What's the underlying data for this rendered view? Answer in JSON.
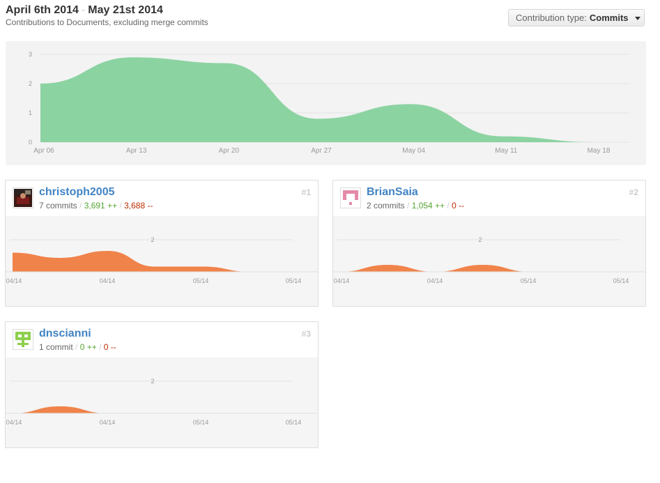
{
  "header": {
    "start_date": "April 6th 2014",
    "separator": "-",
    "end_date": "May 21st 2014",
    "subtitle": "Contributions to Documents, excluding merge commits"
  },
  "contribution_type": {
    "label": "Contribution type:",
    "value": "Commits"
  },
  "colors": {
    "main_area": "#8cd3a2",
    "contributor_area": "#f0834a",
    "link": "#4183c4",
    "additions": "#55a532",
    "deletions": "#bd2c00"
  },
  "chart_data": [
    {
      "type": "area",
      "x": [
        "Apr 06",
        "Apr 13",
        "Apr 20",
        "Apr 27",
        "May 04",
        "May 11",
        "May 18"
      ],
      "values": [
        2,
        2.9,
        2.7,
        0.8,
        1.3,
        0.2,
        0
      ],
      "tick_labels": [
        "Apr 06",
        "Apr 13",
        "Apr 20",
        "Apr 27",
        "May 04",
        "May 11",
        "May 18"
      ],
      "yticks": [
        "0",
        "1",
        "2",
        "3"
      ],
      "ylim": [
        0,
        3
      ],
      "grid": true
    },
    {
      "type": "area",
      "series_owner": "christoph2005",
      "values": [
        1.1,
        0.8,
        1.2,
        0.3,
        0.3,
        0,
        0
      ],
      "tick_labels": [
        "04/14",
        "04/14",
        "05/14",
        "05/14"
      ],
      "ytick": "2",
      "ylim": [
        0,
        2
      ]
    },
    {
      "type": "area",
      "series_owner": "BrianSaia",
      "values": [
        0,
        0.4,
        0,
        0.4,
        0,
        0,
        0
      ],
      "tick_labels": [
        "04/14",
        "04/14",
        "05/14",
        "05/14"
      ],
      "ytick": "2",
      "ylim": [
        0,
        2
      ]
    },
    {
      "type": "area",
      "series_owner": "dnscianni",
      "values": [
        0,
        0.4,
        0,
        0,
        0,
        0,
        0
      ],
      "tick_labels": [
        "04/14",
        "04/14",
        "05/14",
        "05/14"
      ],
      "ytick": "2",
      "ylim": [
        0,
        2
      ]
    }
  ],
  "contributors": [
    {
      "name": "christoph2005",
      "commits": "7 commits",
      "additions": "3,691 ++",
      "deletions": "3,688 --",
      "rank": "#1",
      "avatar": "photo-avatar"
    },
    {
      "name": "BrianSaia",
      "commits": "2 commits",
      "additions": "1,054 ++",
      "deletions": "0 --",
      "rank": "#2",
      "avatar": "pink-identicon"
    },
    {
      "name": "dnscianni",
      "commits": "1 commit",
      "additions": "0 ++",
      "deletions": "0 --",
      "rank": "#3",
      "avatar": "green-identicon"
    }
  ]
}
